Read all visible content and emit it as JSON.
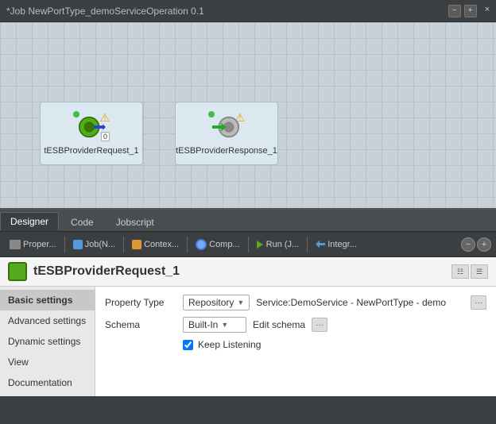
{
  "titleBar": {
    "title": "*Job NewPortType_demoServiceOperation 0.1",
    "closeLabel": "×"
  },
  "toolbar": {
    "items": [
      {
        "id": "proper",
        "label": "Proper..."
      },
      {
        "id": "job",
        "label": "Job(N..."
      },
      {
        "id": "context",
        "label": "Contex..."
      },
      {
        "id": "comp",
        "label": "Comp..."
      },
      {
        "id": "run",
        "label": "Run (J..."
      },
      {
        "id": "integ",
        "label": "Integr..."
      }
    ]
  },
  "tabs": [
    {
      "id": "designer",
      "label": "Designer",
      "active": true
    },
    {
      "id": "code",
      "label": "Code",
      "active": false
    },
    {
      "id": "jobscript",
      "label": "Jobscript",
      "active": false
    }
  ],
  "nodes": [
    {
      "id": "node1",
      "label": "tESBProviderRequest_1",
      "type": "request",
      "counter": "0",
      "hasWarning": true
    },
    {
      "id": "node2",
      "label": "tESBProviderResponse_1",
      "type": "response",
      "hasWarning": true
    }
  ],
  "componentHeader": {
    "title": "tESBProviderRequest_1"
  },
  "leftNav": {
    "items": [
      {
        "id": "basic",
        "label": "Basic settings",
        "active": true
      },
      {
        "id": "advanced",
        "label": "Advanced settings",
        "active": false
      },
      {
        "id": "dynamic",
        "label": "Dynamic settings",
        "active": false
      },
      {
        "id": "view",
        "label": "View",
        "active": false
      },
      {
        "id": "documentation",
        "label": "Documentation",
        "active": false
      }
    ]
  },
  "settings": {
    "rows": [
      {
        "id": "property-type",
        "label": "Property Type",
        "dropdownValue": "Repository",
        "extraValue": "Service:DemoService - NewPortType - demo",
        "hasEllipsis": true
      },
      {
        "id": "schema",
        "label": "Schema",
        "dropdownValue": "Built-In",
        "extraValue": "Edit schema",
        "hasEllipsis": true
      }
    ],
    "checkbox": {
      "label": "Keep Listening",
      "checked": true
    }
  },
  "colors": {
    "accent": "#55aa22",
    "tabActive": "#3c3f41",
    "sidebar": "#4a4d50"
  }
}
